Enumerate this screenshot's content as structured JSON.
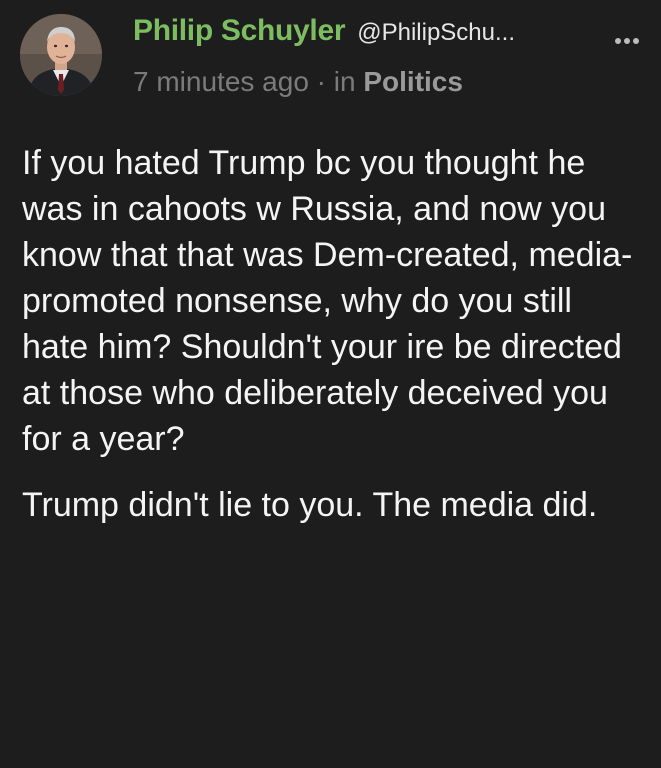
{
  "post": {
    "author_name": "Philip Schuyler",
    "author_handle": "@PhilipSchu...",
    "timestamp": "7 minutes ago",
    "separator": "·",
    "category_prefix": "in",
    "category": "Politics",
    "paragraphs": [
      "If you hated Trump bc you thought he was in cahoots w Russia, and now you know that that was Dem-created, media-promoted nonsense, why do you still hate him? Shouldn't your ire be directed at those who deliberately deceived you for a year?",
      "Trump didn't lie to you. The media did."
    ]
  },
  "icons": {
    "more": "more-options-icon",
    "avatar": "profile-photo"
  },
  "colors": {
    "background": "#1d1d1d",
    "author_name": "#7dbd61",
    "meta_text": "#7b7b7b",
    "body_text": "#f4f4f4"
  }
}
